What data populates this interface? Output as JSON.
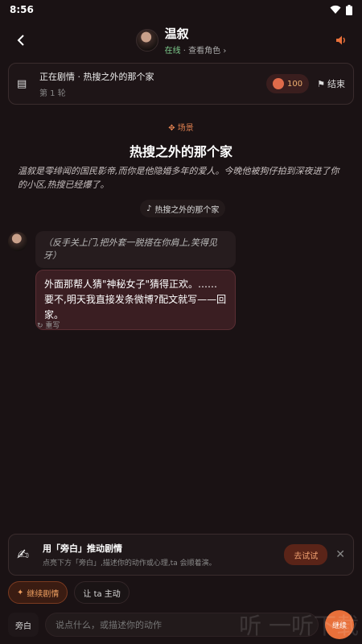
{
  "status": {
    "time": "8:56"
  },
  "header": {
    "name": "温叙",
    "online": "在线",
    "sep": " · ",
    "view_role": "查看角色 ›"
  },
  "plot": {
    "title": "正在剧情 · 热搜之外的那个家",
    "round": "第 1 轮",
    "coins": "100",
    "end_label": "结束"
  },
  "scene": {
    "tag": "场景",
    "title": "热搜之外的那个家",
    "description": "温叙是零绯闻的国民影帝,而你是他隐婚多年的爱人。今晚他被狗仔拍到深夜进了你的小区,热搜已经爆了。",
    "music": "热搜之外的那个家"
  },
  "messages": {
    "action": "（反手关上门,把外套一脱搭在你肩上,笑得见牙）",
    "speech": "外面那帮人猜\"神秘女子\"猜得正欢。……要不,明天我直接发条微博?配文就写——回家。",
    "rewrite": "重写"
  },
  "tip": {
    "title": "用「旁白」推动剧情",
    "subtitle": "点亮下方「旁白」,描述你的动作或心理,ta 会顺着演。",
    "try_label": "去试试"
  },
  "chips": {
    "continue_story": "继续剧情",
    "let_ta": "让 ta 主动"
  },
  "input": {
    "narration": "旁白",
    "placeholder": "说点什么，或描述你的动作",
    "continue": "继续"
  },
  "watermark": "听 一听下载",
  "colors": {
    "accent": "#e8703a",
    "background": "#1a1214",
    "online": "#7fcf8f"
  }
}
